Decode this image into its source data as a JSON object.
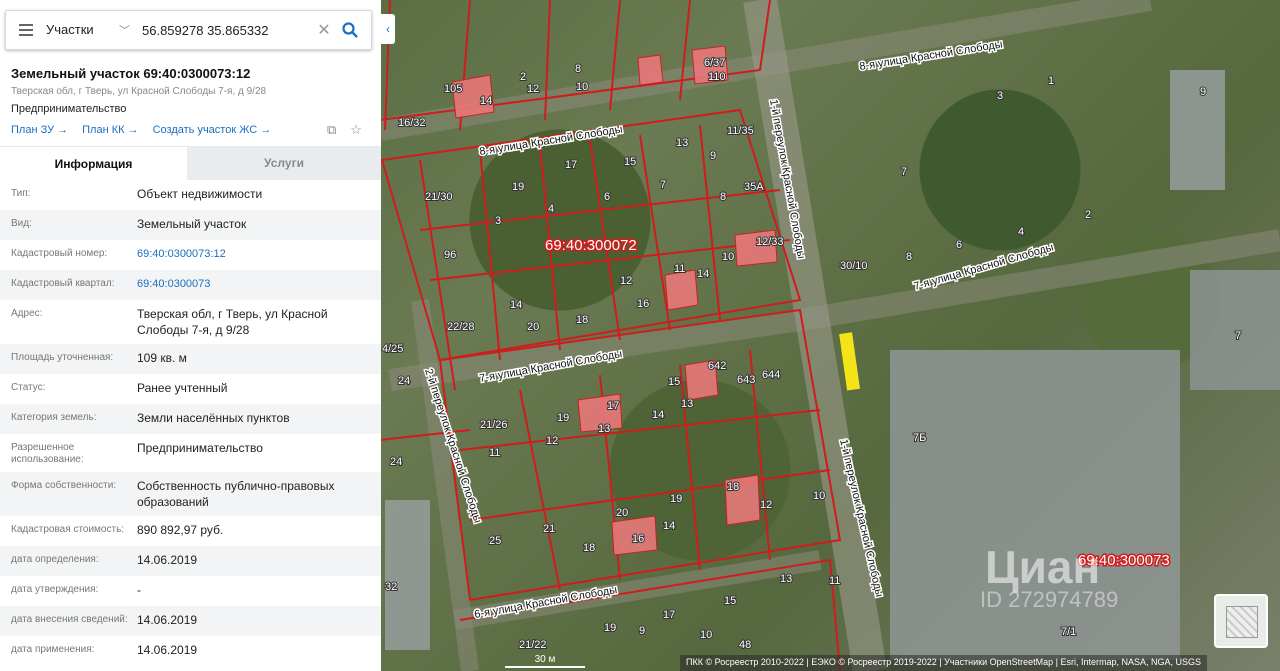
{
  "search": {
    "layer": "Участки",
    "query": "56.859278 35.865332"
  },
  "parcel": {
    "title": "Земельный участок 69:40:0300073:12",
    "address_sub": "Тверская обл, г Тверь, ул Красной Слободы 7-я, д 9/28",
    "usage": "Предпринимательство",
    "links": [
      "План ЗУ →",
      "План КК →",
      "Создать участок ЖС →"
    ]
  },
  "tabs": {
    "info": "Информация",
    "services": "Услуги"
  },
  "rows": [
    {
      "k": "Тип:",
      "v": "Объект недвижимости"
    },
    {
      "k": "Вид:",
      "v": "Земельный участок"
    },
    {
      "k": "Кадастровый номер:",
      "v": "69:40:0300073:12",
      "link": true
    },
    {
      "k": "Кадастровый квартал:",
      "v": "69:40:0300073",
      "link": true
    },
    {
      "k": "Адрес:",
      "v": "Тверская обл, г Тверь, ул Красной Слободы 7-я, д 9/28"
    },
    {
      "k": "Площадь уточненная:",
      "v": "109 кв. м"
    },
    {
      "k": "Статус:",
      "v": "Ранее учтенный"
    },
    {
      "k": "Категория земель:",
      "v": "Земли населённых пунктов"
    },
    {
      "k": "Разрешенное использование:",
      "v": "Предпринимательство"
    },
    {
      "k": "Форма собственности:",
      "v": "Собственность публично-правовых образований"
    },
    {
      "k": "Кадастровая стоимость:",
      "v": "890 892,97 руб."
    },
    {
      "k": "дата определения:",
      "v": "14.06.2019"
    },
    {
      "k": "дата утверждения:",
      "v": "-"
    },
    {
      "k": "дата внесения сведений:",
      "v": "14.06.2019"
    },
    {
      "k": "дата применения:",
      "v": "14.06.2019"
    }
  ],
  "map": {
    "streets": [
      "8-я улица Красной Слободы",
      "8-я улица Красной Слободы",
      "7-я улица Красной Слободы",
      "7-я улица Красной Слободы",
      "6-я улица Красной Слободы",
      "1-й переулок Красной Слободы",
      "1-й переулок Красной Слободы",
      "2-й переулок Красной Слободы"
    ],
    "quarters": [
      "69:40:300072",
      "69:40:300073"
    ],
    "labels": [
      "105",
      "2",
      "8",
      "6/37",
      "110",
      "12",
      "14",
      "10",
      "16/32",
      "11/35",
      "13",
      "15",
      "17",
      "9",
      "21/30",
      "19",
      "7",
      "6",
      "8",
      "35А",
      "12/33",
      "3",
      "4",
      "10",
      "96",
      "11",
      "14",
      "16",
      "22/28",
      "14",
      "20",
      "18",
      "12",
      "30/10",
      "7",
      "6",
      "8",
      "4",
      "2",
      "1",
      "3",
      "9",
      "4/25",
      "24",
      "17",
      "15",
      "13",
      "14",
      "12",
      "21/26",
      "19",
      "11",
      "13",
      "642",
      "643",
      "644",
      "7Б",
      "24",
      "18",
      "12",
      "10",
      "21",
      "20",
      "19",
      "14",
      "16",
      "18",
      "25",
      "11",
      "15",
      "13",
      "17",
      "21/22",
      "19",
      "9",
      "10",
      "48",
      "7/1",
      "32",
      "7"
    ],
    "attribution": "ПКК © Росреестр 2010-2022 | ЕЭКО © Росреестр 2019-2022 | Участники OpenStreetMap | Esri, Intermap, NASA, NGA, USGS",
    "scale": "30 м",
    "watermark": "Циан",
    "watermark_id": "ID 272974789",
    "colors": {
      "boundary": "#d01c1c",
      "parcel_fill": "#e8787a",
      "highlight": "#f5e31a"
    }
  }
}
